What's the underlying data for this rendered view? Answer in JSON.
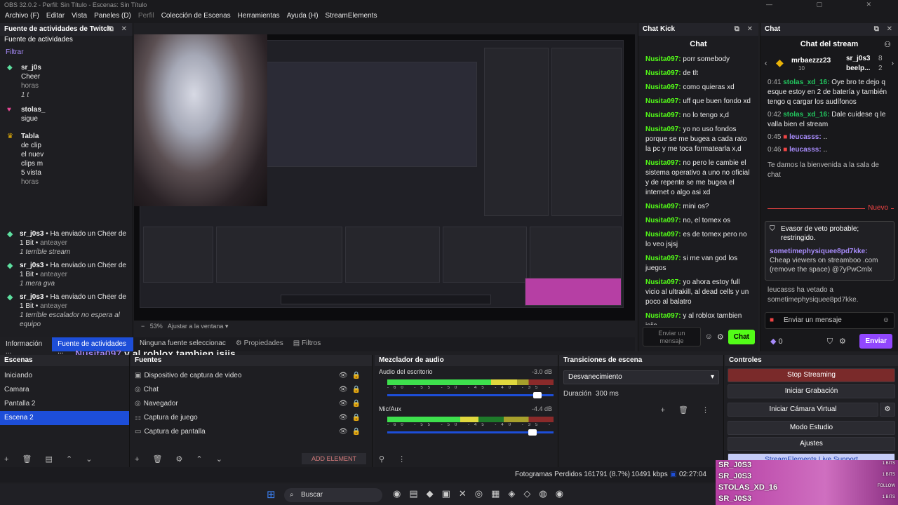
{
  "window": {
    "title": "OBS 32.0.2 - Perfil: Sin Título - Escenas: Sin Título"
  },
  "menu": [
    "Archivo (F)",
    "Editar",
    "Vista",
    "Paneles (D)",
    "Perfil",
    "Colección de Escenas",
    "Herramientas",
    "Ayuda (H)",
    "StreamElements"
  ],
  "activity": {
    "title": "Fuente de actividades de Twitch",
    "subtitle": "Fuente de actividades",
    "filter": "Filtrar",
    "events": [
      {
        "user": "sr_j0s",
        "line1": "Cheer",
        "line2": "horas",
        "icon": "diamond-icon",
        "msg": "1 t"
      },
      {
        "user": "stolas_",
        "line1": "sigue",
        "icon": "heart-icon"
      },
      {
        "user": "Tabla",
        "line1": "de clip",
        "line2": "el nuev",
        "line3": "clips m",
        "line4": "5 vista",
        "line5": "horas",
        "icon": "crown-icon"
      },
      {
        "user": "sr_j0s3",
        "line1": "Ha enviado un Cheer de 1 Bit",
        "time": "anteayer",
        "msg": "1 terrible stream",
        "icon": "diamond-icon"
      },
      {
        "user": "sr_j0s3",
        "line1": "Ha enviado un Cheer de 1 Bit",
        "time": "anteayer",
        "msg": "1 mera gva",
        "icon": "diamond-icon"
      },
      {
        "user": "sr_j0s3",
        "line1": "Ha enviado un Cheer de 1 Bit",
        "time": "anteayer",
        "msg": "1 terrible escalador no espera al equipo",
        "icon": "diamond-icon"
      }
    ]
  },
  "tabs": {
    "info": "Información ...",
    "feed": "Fuente de actividades ..."
  },
  "props": {
    "none": "Ninguna fuente seleccionac",
    "properties": "Propiedades",
    "filters": "Filtros"
  },
  "caption": {
    "user": "Nusita097",
    "text": "y al roblox tambien jsjjs"
  },
  "zoom": {
    "value": "53%",
    "fit": "Ajustar a la ventana"
  },
  "kick": {
    "title": "Chat Kick",
    "header": "Chat",
    "messages": [
      {
        "user": "Nusita097:",
        "text": "porr somebody"
      },
      {
        "user": "Nusita097:",
        "text": "de tlt"
      },
      {
        "user": "Nusita097:",
        "text": "como quieras xd"
      },
      {
        "user": "Nusita097:",
        "text": "uff que buen fondo xd"
      },
      {
        "user": "Nusita097:",
        "text": "no lo tengo x,d"
      },
      {
        "user": "Nusita097:",
        "text": "yo no uso fondos porque se me bugea a cada rato la pc y me toca formatearla x,d"
      },
      {
        "user": "Nusita097:",
        "text": "no pero le cambie el sistema operativo a uno no oficial y de repente se me bugea el internet o algo asi xd"
      },
      {
        "user": "Nusita097:",
        "text": "mini os?"
      },
      {
        "user": "Nusita097:",
        "text": "no, el tomex os"
      },
      {
        "user": "Nusita097:",
        "text": "es de tomex pero no lo veo jsjsj"
      },
      {
        "user": "Nusita097:",
        "text": "si me van god los juegos"
      },
      {
        "user": "Nusita097:",
        "text": "yo ahora estoy full vicio al ultrakill, al dead cells y un poco al balatro"
      },
      {
        "user": "Nusita097:",
        "text": "y al roblox tambien jsjjs"
      }
    ],
    "input_placeholder": "Enviar un mensaje",
    "send": "Chat"
  },
  "chat2": {
    "title": "Chat",
    "header": "Chat del stream",
    "top_user": "mrbaezzz23",
    "top_count": "10",
    "side_users": [
      "sr_j0s3",
      "beelp..."
    ],
    "side_counts": [
      "8",
      "2"
    ],
    "rows": [
      {
        "time": "0:41",
        "user": "stolas_xd_16:",
        "text": "Oye bro te dejo q esque estoy en 2 de batería y también tengo q cargar los audífonos"
      },
      {
        "time": "0:42",
        "user": "stolas_xd_16:",
        "text": "Dale cuídese q le valla bien el stream"
      },
      {
        "time": "0:45",
        "user": "leucasss:",
        "text": ".."
      },
      {
        "time": "0:46",
        "user": "leucasss:",
        "text": ".."
      }
    ],
    "welcome": "Te damos la bienvenida a la sala de chat",
    "new_label": "Nuevo",
    "evasor_title": "Evasor de veto probable; restringido.",
    "evasor_user": "sometimephysiquee8pd7kke:",
    "evasor_msg": "Cheap viewers on streamboo .com (remove the space) @7yPwCmlx",
    "ban_msg": "leucasss ha vetado a sometimephysiquee8pd7kke.",
    "input_placeholder": "Enviar un mensaje",
    "points": "0",
    "send": "Enviar"
  },
  "scenes": {
    "title": "Escenas",
    "items": [
      "Iniciando",
      "Camara",
      "Pantalla 2",
      "Escena 2"
    ],
    "selected": 3
  },
  "sources": {
    "title": "Fuentes",
    "items": [
      "Dispositivo de captura de video",
      "Chat",
      "Navegador",
      "Captura de juego",
      "Captura de pantalla"
    ],
    "add": "ADD ELEMENT"
  },
  "mixer": {
    "title": "Mezclador de audio",
    "channels": [
      {
        "name": "Audio del escritorio",
        "db": "-3.0 dB",
        "level": 0.78,
        "volume": 0.93
      },
      {
        "name": "Mic/Aux",
        "db": "-4.4 dB",
        "level": 0.55,
        "volume": 0.9
      }
    ],
    "scale": [
      "-60",
      "-55",
      "-50",
      "-45",
      "-40",
      "-35",
      "-30",
      "-25",
      "-20",
      "-15",
      "-10",
      "-5",
      "0"
    ]
  },
  "transitions": {
    "title": "Transiciones de escena",
    "type": "Desvanecimiento",
    "duration_label": "Duración",
    "duration": "300 ms"
  },
  "controls": {
    "title": "Controles",
    "buttons": [
      "Stop Streaming",
      "Iniciar Grabación",
      "Iniciar Cámara Virtual",
      "Modo Estudio",
      "Ajustes",
      "StreamElements Live Support"
    ]
  },
  "status": {
    "dropped": "Fotogramas Perdidos 161791 (8.7%)",
    "bitrate": "10491 kbps",
    "time": "02:27:04"
  },
  "taskbar": {
    "search": "Buscar"
  },
  "alerts": [
    {
      "name": "SR_J0S3",
      "tag": "1 BITS"
    },
    {
      "name": "SR_J0S3",
      "tag": "1 BITS"
    },
    {
      "name": "STOLAS_XD_16",
      "tag": "FOLLOW"
    },
    {
      "name": "SR_J0S3",
      "tag": "1 BITS"
    }
  ]
}
